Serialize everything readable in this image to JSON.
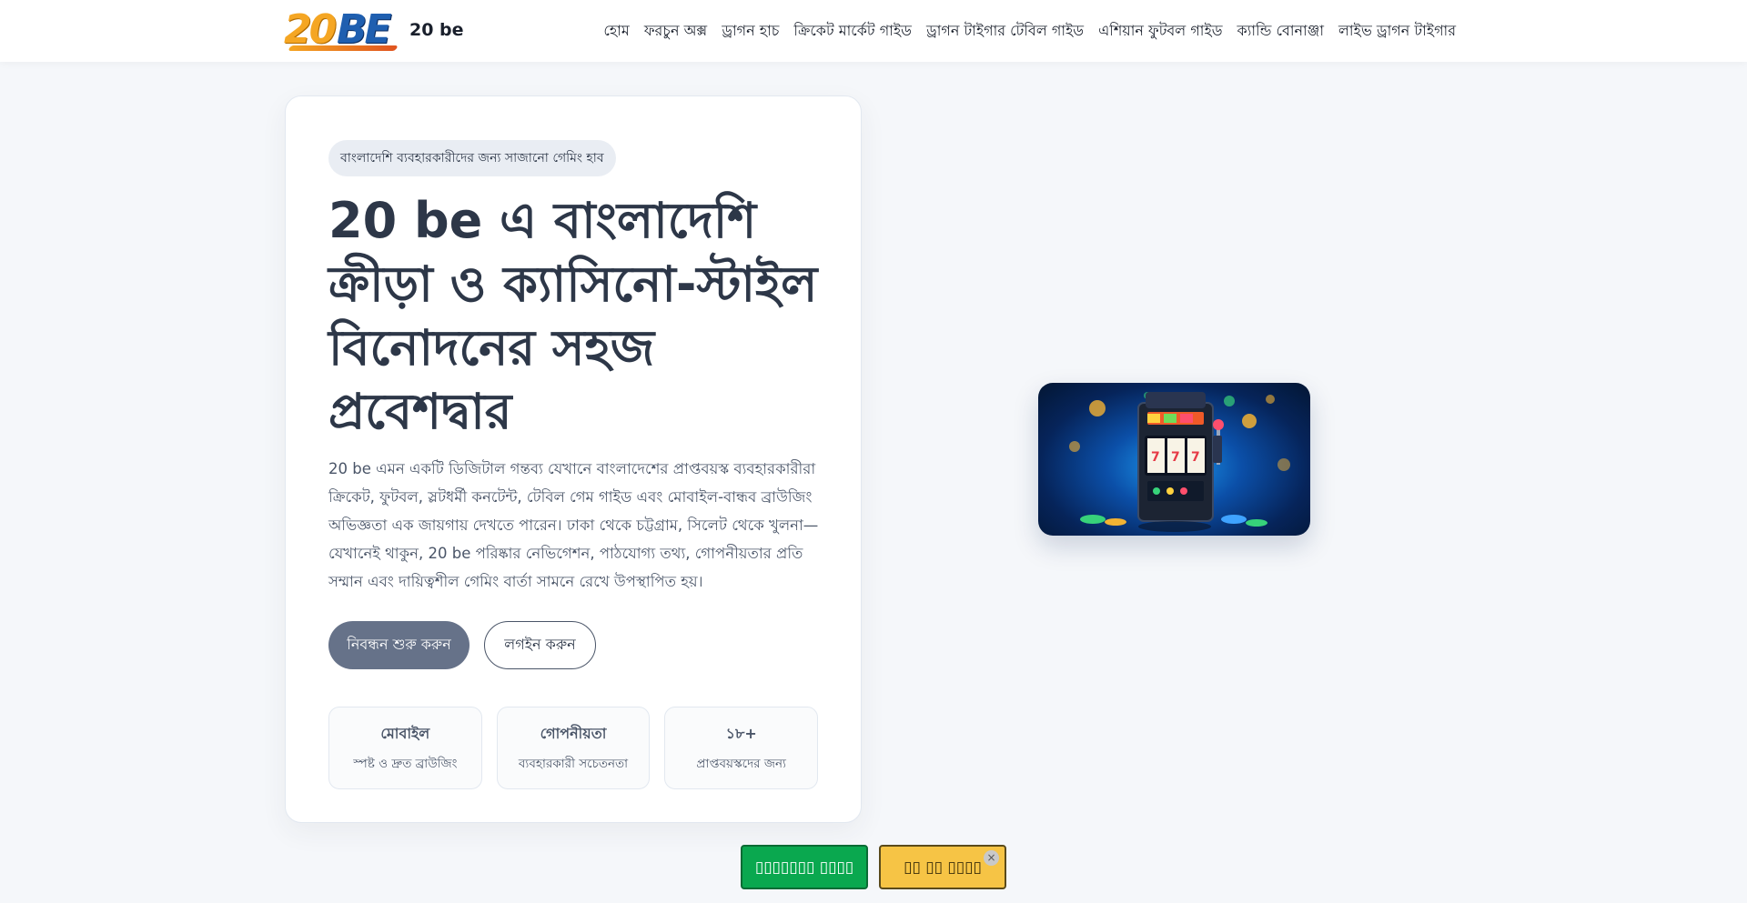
{
  "header": {
    "logo_digits": "20",
    "logo_letters": "BE",
    "brand_name": "20 be",
    "nav": [
      "হোম",
      "ফরচুন অক্স",
      "ড্রাগন হাচ",
      "ক্রিকেট মার্কেট গাইড",
      "ড্রাগন টাইগার টেবিল গাইড",
      "এশিয়ান ফুটবল গাইড",
      "ক্যান্ডি বোনাঞ্জা",
      "লাইভ ড্রাগন টাইগার"
    ]
  },
  "hero": {
    "pill": "বাংলাদেশি ব্যবহারকারীদের জন্য সাজানো গেমিং হাব",
    "title": "20 be এ বাংলাদেশি ক্রীড়া ও ক্যাসিনো-স্টাইল বিনোদনের সহজ প্রবেশদ্বার",
    "text": "20 be এমন একটি ডিজিটাল গন্তব্য যেখানে বাংলাদেশের প্রাপ্তবয়স্ক ব্যবহারকারীরা ক্রিকেট, ফুটবল, স্লটধর্মী কনটেন্ট, টেবিল গেম গাইড এবং মোবাইল-বান্ধব ব্রাউজিং অভিজ্ঞতা এক জায়গায় দেখতে পারেন। ঢাকা থেকে চট্টগ্রাম, সিলেট থেকে খুলনা—যেখানেই থাকুন, 20 be পরিষ্কার নেভিগেশন, পাঠযোগ্য তথ্য, গোপনীয়তার প্রতি সম্মান এবং দায়িত্বশীল গেমিং বার্তা সামনে রেখে উপস্থাপিত হয়।",
    "primary_button": "নিবন্ধন শুরু করুন",
    "secondary_button": "লগইন করুন",
    "stats": [
      {
        "title": "মোবাইল",
        "subtitle": "স্পষ্ট ও দ্রুত ব্রাউজিং"
      },
      {
        "title": "গোপনীয়তা",
        "subtitle": "ব্যবহারকারী সচেতনতা"
      },
      {
        "title": "১৮+",
        "subtitle": "প্রাপ্তবয়স্কদের জন্য"
      }
    ]
  },
  "floating": {
    "green_label": "▯▯▯▯▯▯▯ ▯▯▯▯",
    "yellow_label": "▯▯ ▯▯ ▯▯▯▯",
    "close_glyph": "×"
  },
  "colors": {
    "primary_button": "#667289",
    "green": "#0aa84f",
    "yellow": "#f6c445",
    "title_text": "#2d3748"
  }
}
